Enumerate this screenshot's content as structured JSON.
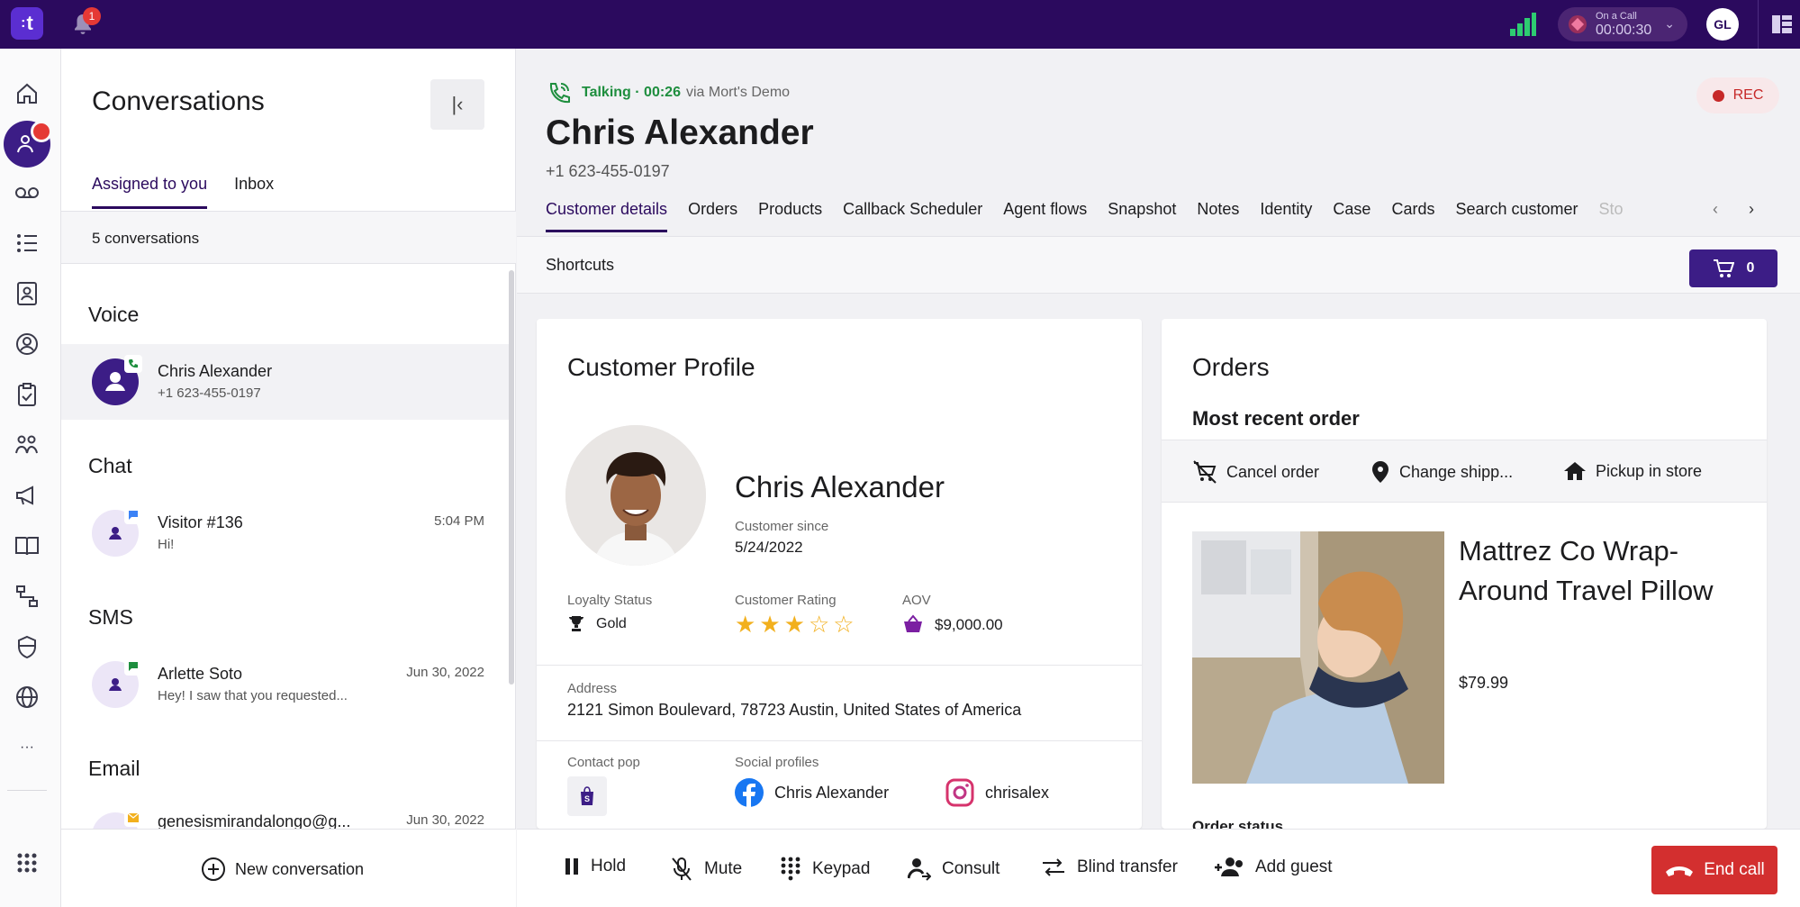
{
  "topbar": {
    "logo_text": "t",
    "notification_count": "1",
    "on_call_label": "On a Call",
    "on_call_timer": "00:00:30",
    "user_initials": "GL"
  },
  "conversations": {
    "title": "Conversations",
    "tabs": [
      "Assigned to you",
      "Inbox"
    ],
    "count_text": "5 conversations",
    "sections": {
      "voice": "Voice",
      "chat": "Chat",
      "sms": "SMS",
      "email": "Email"
    },
    "items": [
      {
        "name": "Chris Alexander",
        "sub": "+1 623-455-0197",
        "time": ""
      },
      {
        "name": "Visitor #136",
        "sub": "Hi!",
        "time": "5:04 PM"
      },
      {
        "name": "Arlette Soto",
        "sub": "Hey! I saw that you requested...",
        "time": "Jun 30, 2022"
      },
      {
        "name": "genesismirandalongo@g...",
        "sub": "",
        "time": "Jun 30, 2022"
      }
    ],
    "new_conversation": "New conversation"
  },
  "call_header": {
    "status": "Talking · 00:26",
    "via": "via Mort's Demo",
    "customer_name": "Chris Alexander",
    "customer_phone": "+1 623-455-0197",
    "rec_label": "REC"
  },
  "tabs": [
    "Customer details",
    "Orders",
    "Products",
    "Callback Scheduler",
    "Agent flows",
    "Snapshot",
    "Notes",
    "Identity",
    "Case",
    "Cards",
    "Search customer",
    "Sto"
  ],
  "shortcuts": {
    "label": "Shortcuts",
    "cart_count": "0"
  },
  "profile": {
    "title": "Customer Profile",
    "name": "Chris Alexander",
    "customer_since_label": "Customer since",
    "customer_since": "5/24/2022",
    "loyalty_label": "Loyalty Status",
    "loyalty_value": "Gold",
    "rating_label": "Customer Rating",
    "rating": 3,
    "rating_max": 5,
    "aov_label": "AOV",
    "aov_value": "$9,000.00",
    "address_label": "Address",
    "address": "2121 Simon Boulevard, 78723 Austin, United States of America",
    "contact_pop_label": "Contact pop",
    "social_label": "Social profiles",
    "facebook": "Chris Alexander",
    "instagram": "chrisalex"
  },
  "orders": {
    "title": "Orders",
    "subtitle": "Most recent order",
    "actions": [
      "Cancel order",
      "Change shipp...",
      "Pickup in store"
    ],
    "product_name": "Mattrez Co Wrap-Around Travel Pillow",
    "product_price": "$79.99",
    "status_label": "Order status"
  },
  "callbar": {
    "hold": "Hold",
    "mute": "Mute",
    "keypad": "Keypad",
    "consult": "Consult",
    "blind_transfer": "Blind transfer",
    "add_guest": "Add guest",
    "end_call": "End call"
  },
  "colors": {
    "brand": "#2b0a5e",
    "accent": "#3c1d86",
    "talking_green": "#1e8e3e",
    "end_call_red": "#d32f2f",
    "star_gold": "#f2b01e"
  }
}
